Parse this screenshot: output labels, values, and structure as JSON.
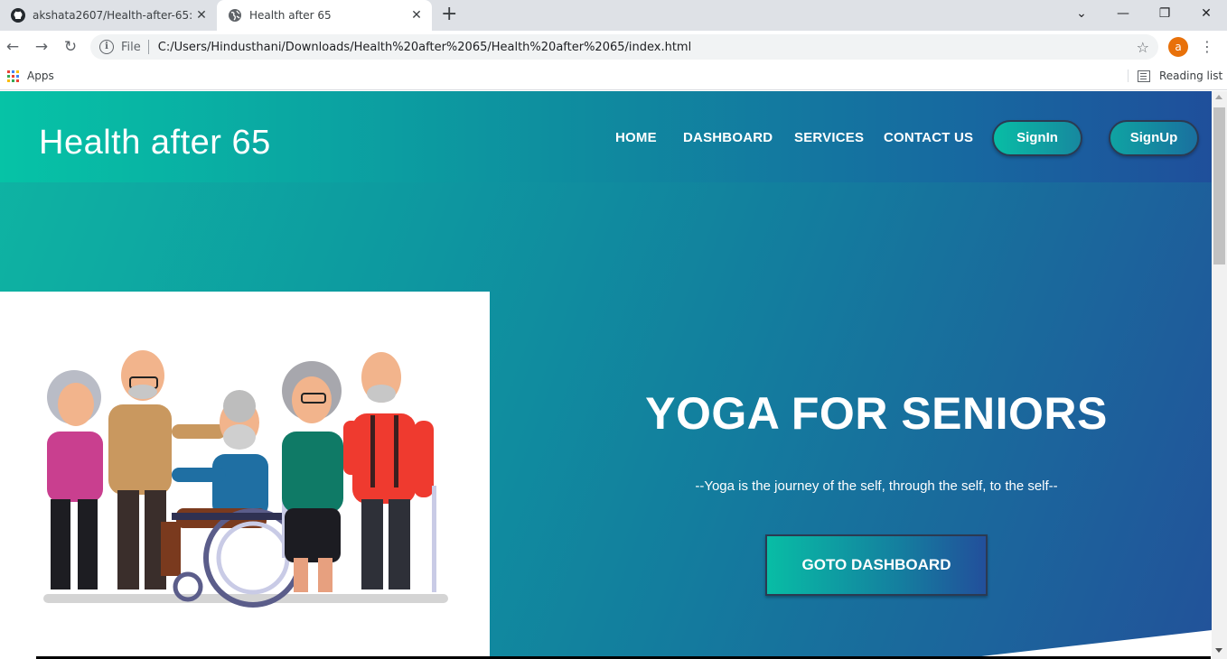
{
  "browser": {
    "tabs": [
      {
        "title": "akshata2607/Health-after-65: Thi",
        "icon": "github-icon"
      },
      {
        "title": "Health after 65",
        "icon": "globe-icon"
      }
    ],
    "omnibox": {
      "scheme_label": "File",
      "url": "C:/Users/Hindusthani/Downloads/Health%20after%2065/Health%20after%2065/index.html"
    },
    "profile_initial": "a",
    "bookmarks": {
      "apps_label": "Apps",
      "reading_list_label": "Reading list"
    }
  },
  "site": {
    "brand": "Health after 65",
    "nav": {
      "home": "HOME",
      "dashboard": "DASHBOARD",
      "services": "SERVICES",
      "contact": "CONTACT US"
    },
    "signin_label": "SignIn",
    "signup_label": "SignUp"
  },
  "hero": {
    "title": "YOGA FOR SENIORS",
    "quote": "--Yoga is the journey of the self, through the self, to the self--",
    "button_label": "GOTO DASHBOARD",
    "illustration": "elderly-group-illustration"
  },
  "colors": {
    "teal": "#06c3a6",
    "blue": "#22529a",
    "chrome_tabbar": "#dee1e6",
    "profile_orange": "#e8710a"
  }
}
